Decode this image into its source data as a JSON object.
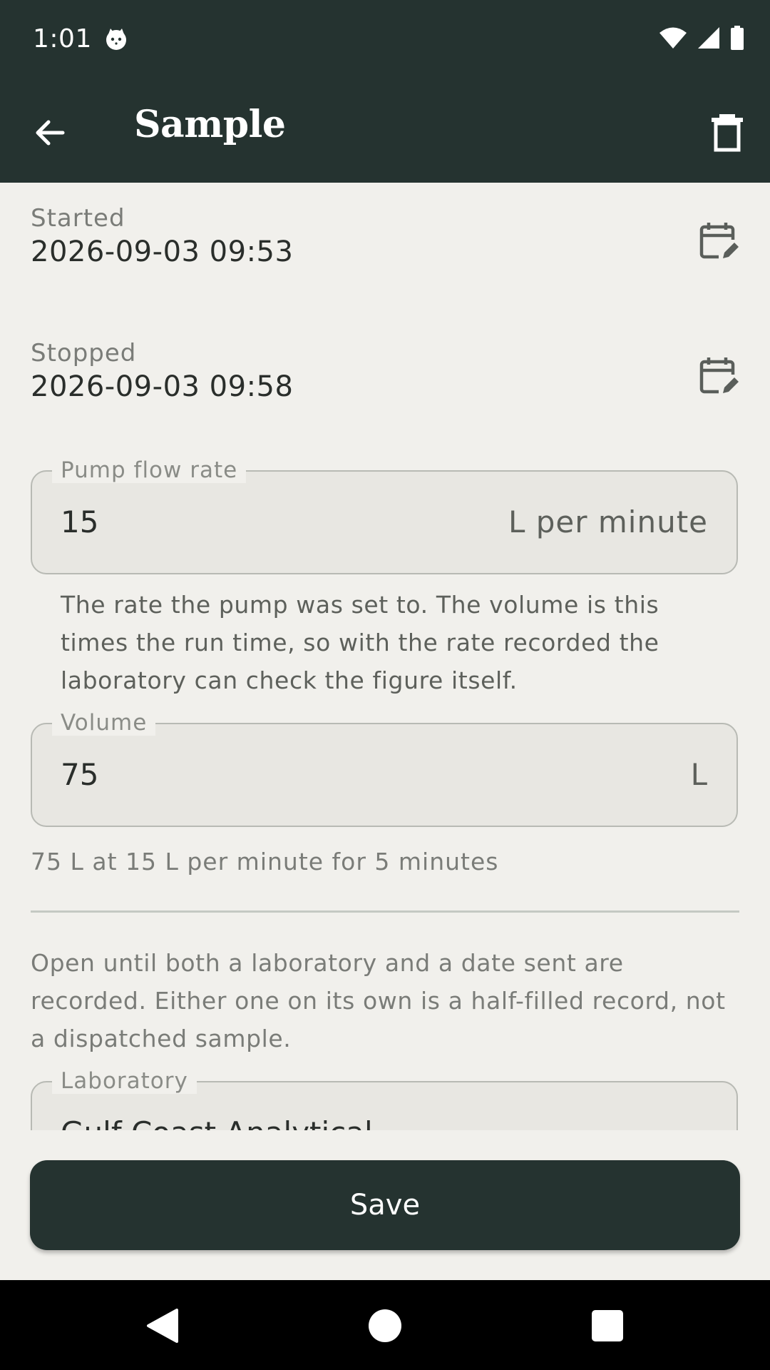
{
  "status_bar": {
    "time": "1:01"
  },
  "app_bar": {
    "title": "Sample"
  },
  "started": {
    "label": "Started",
    "value": "2026-09-03 09:53"
  },
  "stopped": {
    "label": "Stopped",
    "value": "2026-09-03 09:58"
  },
  "pump_flow_rate": {
    "label": "Pump flow rate",
    "value": "15",
    "suffix": "L per minute",
    "helper": "The rate the pump was set to. The volume is this times the run time, so with the rate recorded the laboratory can check the figure itself."
  },
  "volume": {
    "label": "Volume",
    "value": "75",
    "suffix": "L",
    "calculation": "75 L at 15 L per minute for 5 minutes"
  },
  "dispatch_note": "Open until both a laboratory and a date sent are recorded. Either one on its own is a half-filled record, not a dispatched sample.",
  "laboratory": {
    "label": "Laboratory",
    "value": "Gulf Coast Analytical"
  },
  "save_label": "Save",
  "colors": {
    "header_bg": "#253330",
    "page_bg": "#f1f0ec",
    "field_bg": "#e8e7e2",
    "save_bg": "#253330"
  },
  "icons": {
    "back": "arrow-left-icon",
    "delete": "trash-icon",
    "calendar": "calendar-edit-icon",
    "nav_back": "triangle-back-icon",
    "nav_home": "circle-home-icon",
    "nav_recents": "square-recents-icon"
  }
}
